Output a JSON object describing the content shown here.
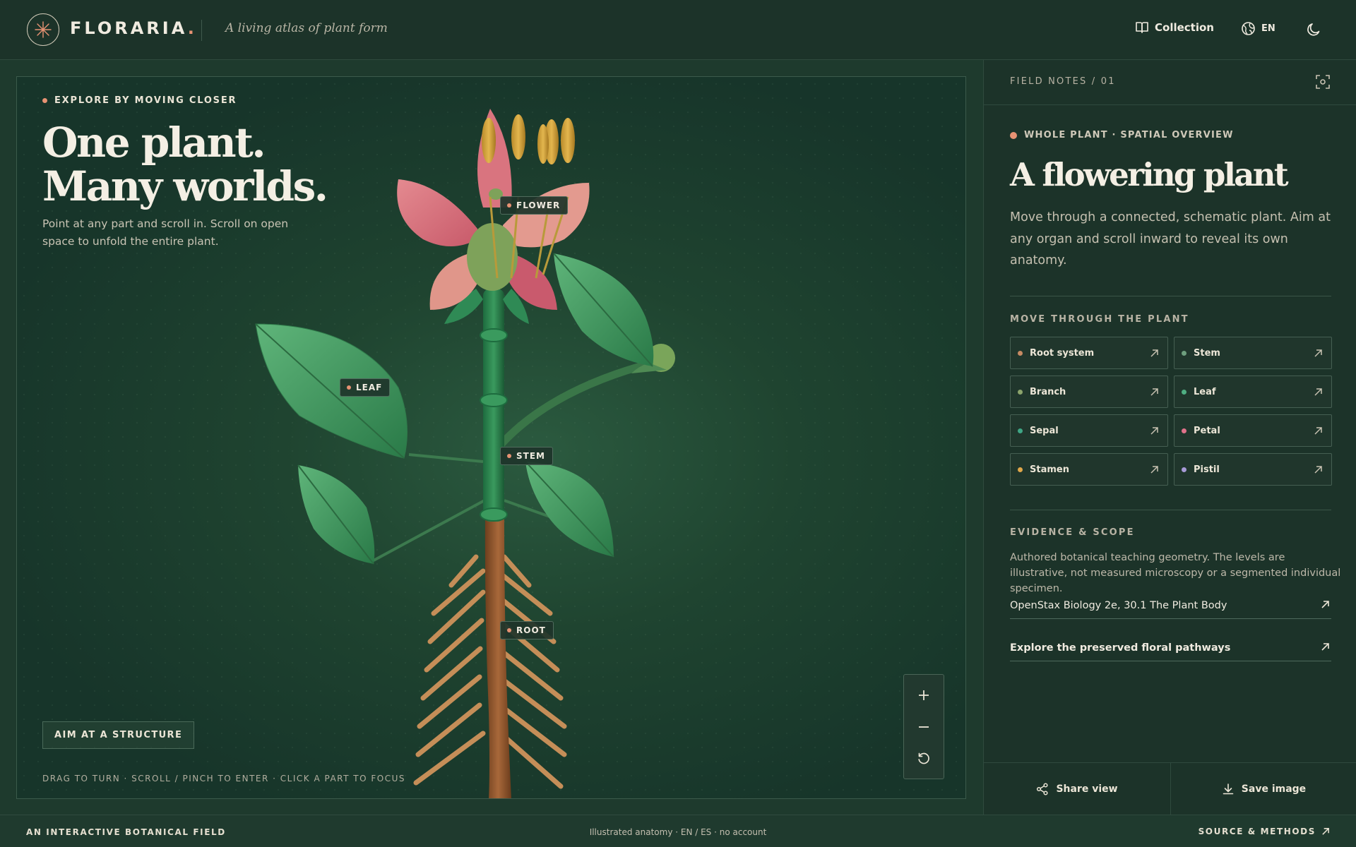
{
  "header": {
    "brand": "FLORARIA",
    "brand_dot": ".",
    "tagline": "A living atlas of plant form",
    "collection_label": "Collection",
    "lang_label": "EN",
    "icons": {
      "logo": "asterisk-flower-icon",
      "collection": "open-book-icon",
      "lang": "globe-icon",
      "theme": "moon-icon"
    }
  },
  "stage": {
    "explore_tag": "EXPLORE BY MOVING CLOSER",
    "hero_line1": "One plant.",
    "hero_line2": "Many worlds.",
    "hero_sub": "Point at any part and scroll in. Scroll on open space to unfold the entire plant.",
    "labels": {
      "flower": "FLOWER",
      "leaf": "LEAF",
      "stem": "STEM",
      "root": "ROOT"
    },
    "aim_button": "AIM AT A STRUCTURE",
    "hint": "DRAG TO TURN · SCROLL / PINCH TO ENTER · CLICK A PART TO FOCUS",
    "zoom_controls": [
      "plus-icon",
      "minus-icon",
      "reset-rotate-icon"
    ]
  },
  "panel": {
    "notes_title": "FIELD NOTES / 01",
    "overview_tag": "WHOLE PLANT · SPATIAL OVERVIEW",
    "title": "A flowering plant",
    "description": "Move through a connected, schematic plant. Aim at any organ and scroll inward to reveal its own anatomy.",
    "move_title": "MOVE THROUGH THE PLANT",
    "parts": [
      {
        "label": "Root system",
        "color": "#c78a63"
      },
      {
        "label": "Stem",
        "color": "#6e9f7e"
      },
      {
        "label": "Branch",
        "color": "#8ca46c"
      },
      {
        "label": "Leaf",
        "color": "#4fae82"
      },
      {
        "label": "Sepal",
        "color": "#3fa685"
      },
      {
        "label": "Petal",
        "color": "#e0728a"
      },
      {
        "label": "Stamen",
        "color": "#e0a74a"
      },
      {
        "label": "Pistil",
        "color": "#a79ad6"
      }
    ],
    "evidence_title": "EVIDENCE & SCOPE",
    "evidence_text": "Authored botanical teaching geometry. The levels are illustrative, not measured microscopy or a segmented individual specimen.",
    "link_source": "OpenStax Biology 2e, 30.1 The Plant Body",
    "link_explore": "Explore the preserved floral pathways",
    "share_label": "Share view",
    "save_label": "Save image"
  },
  "footer": {
    "left": "AN INTERACTIVE BOTANICAL FIELD",
    "center": "Illustrated anatomy · EN / ES · no account",
    "right": "SOURCE & METHODS"
  },
  "colors": {
    "accent": "#e79273",
    "background": "#1c3329"
  }
}
